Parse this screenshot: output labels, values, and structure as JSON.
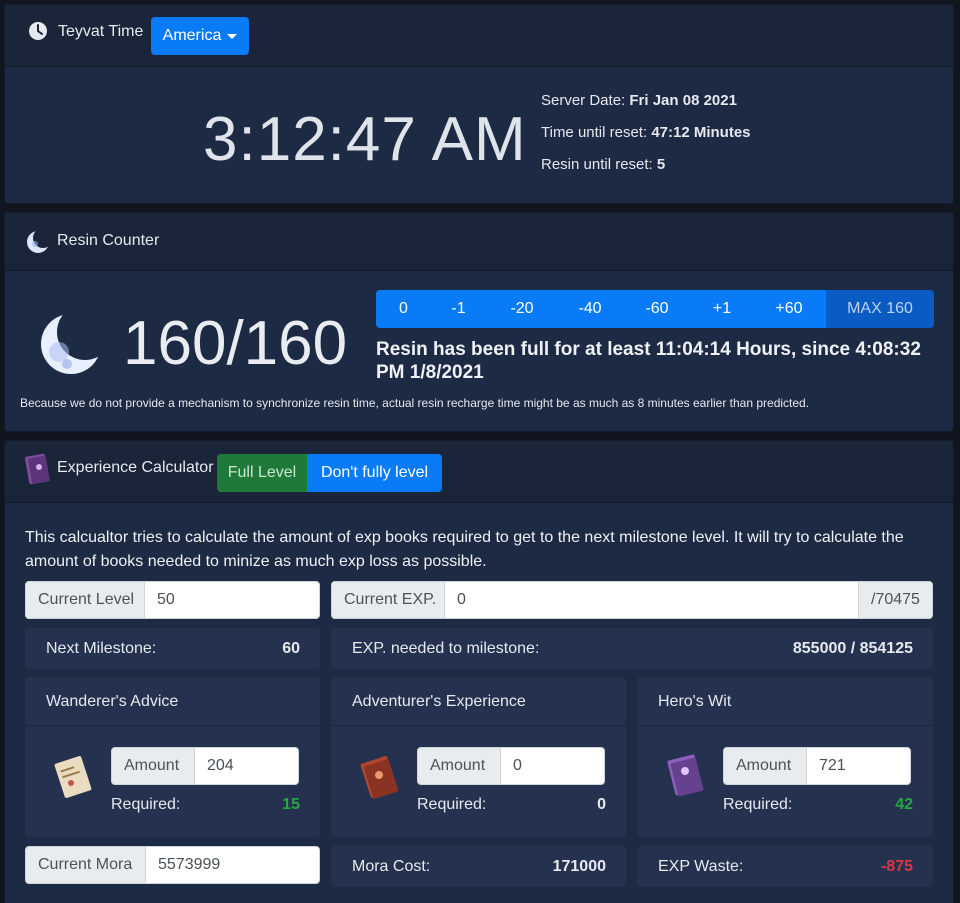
{
  "time": {
    "title": "Teyvat Time",
    "region": "America",
    "clock": "3:12:47 AM",
    "server_date_label": "Server Date:",
    "server_date": "Fri Jan 08 2021",
    "reset_label": "Time until reset:",
    "reset_value": "47:12 Minutes",
    "resin_reset_label": "Resin until reset:",
    "resin_reset_value": "5"
  },
  "resin": {
    "title": "Resin Counter",
    "count": "160/160",
    "buttons": [
      "0",
      "-1",
      "-20",
      "-40",
      "-60",
      "+1",
      "+60",
      "MAX 160"
    ],
    "status": "Resin has been full for at least 11:04:14 Hours, since 4:08:32 PM 1/8/2021",
    "disclaimer": "Because we do not provide a mechanism to synchronize resin time, actual resin recharge time might be as much as 8 minutes earlier than predicted."
  },
  "exp": {
    "title": "Experience Calculator",
    "full_level_label": "Full Level",
    "not_full_label": "Don't fully level",
    "description": "This calcualtor tries to calculate the amount of exp books required to get to the next milestone level. It will try to calculate the amount of books needed to minize as much exp loss as possible.",
    "current_level_label": "Current Level",
    "current_level_value": "50",
    "current_exp_label": "Current EXP.",
    "current_exp_value": "0",
    "current_exp_max": "/70475",
    "next_milestone_label": "Next Milestone:",
    "next_milestone_value": "60",
    "exp_needed_label": "EXP. needed to milestone:",
    "exp_needed_value": "855000 / 854125",
    "books": [
      {
        "name": "Wanderer's Advice",
        "amount_label": "Amount",
        "amount": "204",
        "required_label": "Required:",
        "required": "15",
        "icon": "wanderers-advice-book-icon"
      },
      {
        "name": "Adventurer's Experience",
        "amount_label": "Amount",
        "amount": "0",
        "required_label": "Required:",
        "required": "0",
        "icon": "adventurers-experience-book-icon"
      },
      {
        "name": "Hero's Wit",
        "amount_label": "Amount",
        "amount": "721",
        "required_label": "Required:",
        "required": "42",
        "icon": "heros-wit-book-icon"
      }
    ],
    "mora_label": "Current Mora",
    "mora_value": "5573999",
    "mora_cost_label": "Mora Cost:",
    "mora_cost_value": "171000",
    "exp_waste_label": "EXP Waste:",
    "exp_waste_value": "-875"
  },
  "colors": {
    "accent": "#0a7bf7",
    "success": "#28a745",
    "danger": "#dc3545",
    "card_bg": "#1d2a43",
    "panel_bg": "#24324f"
  }
}
